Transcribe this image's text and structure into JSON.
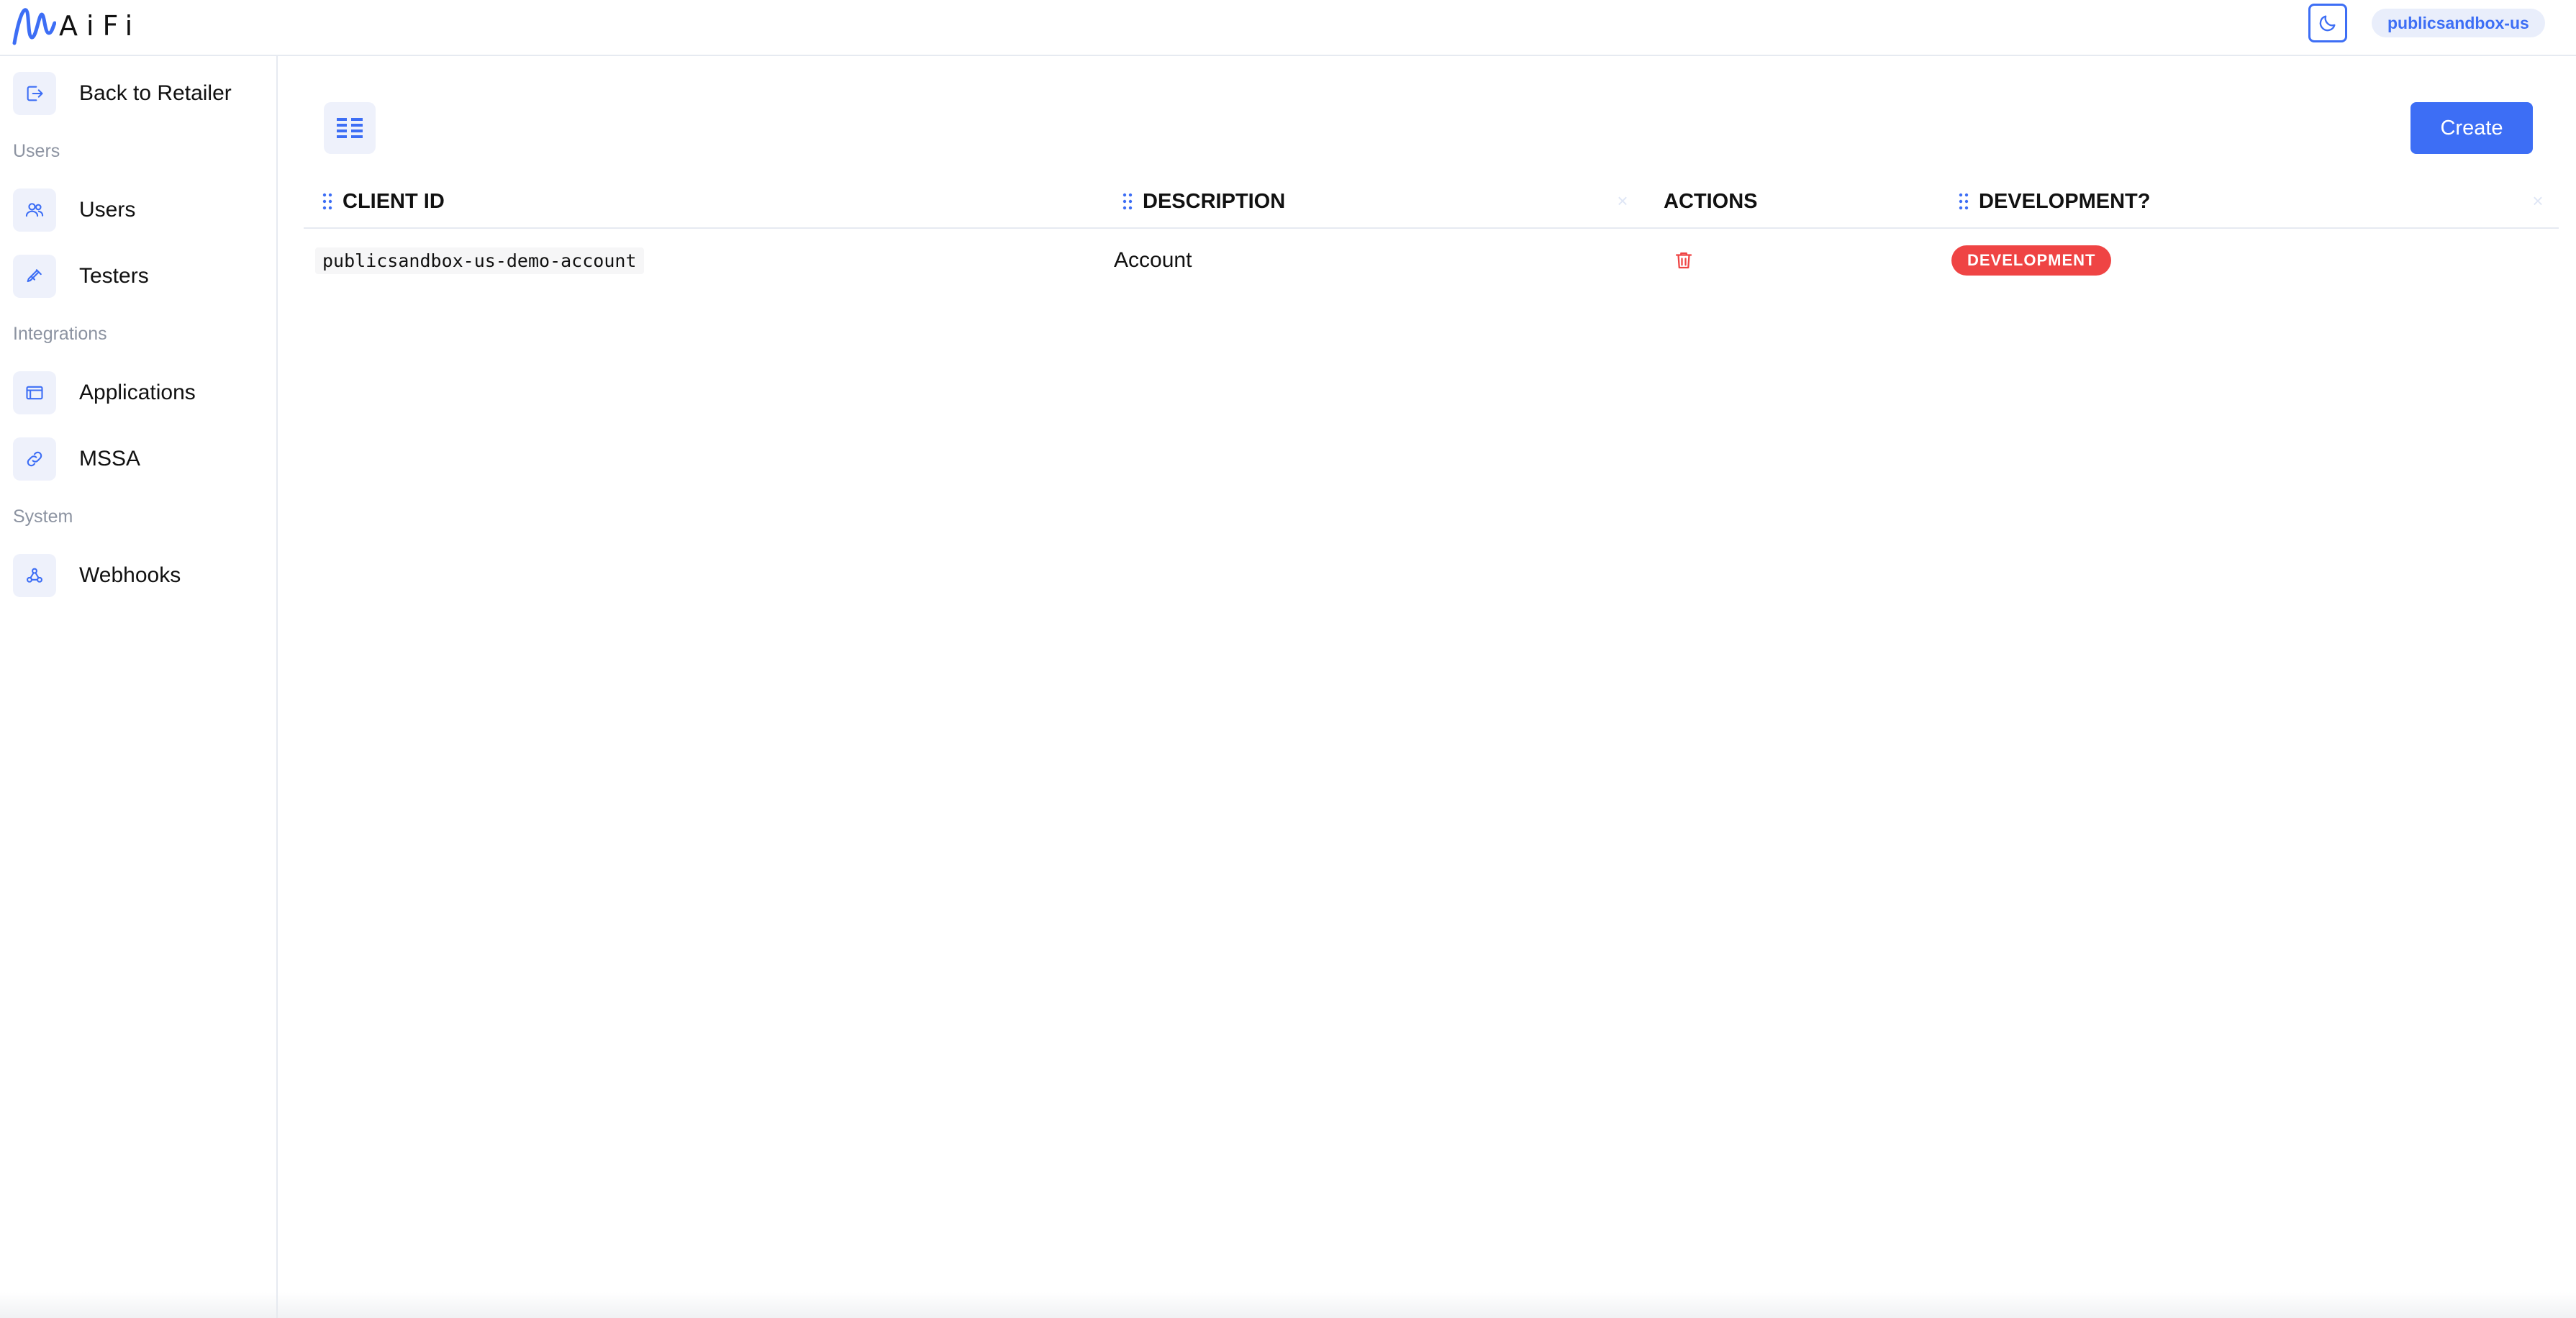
{
  "header": {
    "logo_text": "AiFi",
    "tenant": "publicsandbox-us",
    "theme_toggle_icon": "moon-icon"
  },
  "sidebar": {
    "back": {
      "label": "Back to Retailer",
      "icon": "exit-icon"
    },
    "sections": [
      {
        "label": "Users",
        "items": [
          {
            "label": "Users",
            "icon": "users-icon"
          },
          {
            "label": "Testers",
            "icon": "wrench-icon"
          }
        ]
      },
      {
        "label": "Integrations",
        "items": [
          {
            "label": "Applications",
            "icon": "window-icon"
          },
          {
            "label": "MSSA",
            "icon": "link-icon"
          }
        ]
      },
      {
        "label": "System",
        "items": [
          {
            "label": "Webhooks",
            "icon": "webhook-icon"
          }
        ]
      }
    ]
  },
  "main": {
    "view_toggle_icon": "table-view-icon",
    "create_label": "Create",
    "columns": [
      "CLIENT ID",
      "DESCRIPTION",
      "ACTIONS",
      "DEVELOPMENT?"
    ],
    "rows": [
      {
        "client_id": "publicsandbox-us-demo-account",
        "description": "Account",
        "action_icon": "trash-icon",
        "development": "DEVELOPMENT"
      }
    ]
  },
  "colors": {
    "accent": "#3d6ef5",
    "danger": "#ef4444",
    "icon_bg": "#eef1fb",
    "muted_text": "#8c93a1",
    "border": "#e6eaf1"
  }
}
